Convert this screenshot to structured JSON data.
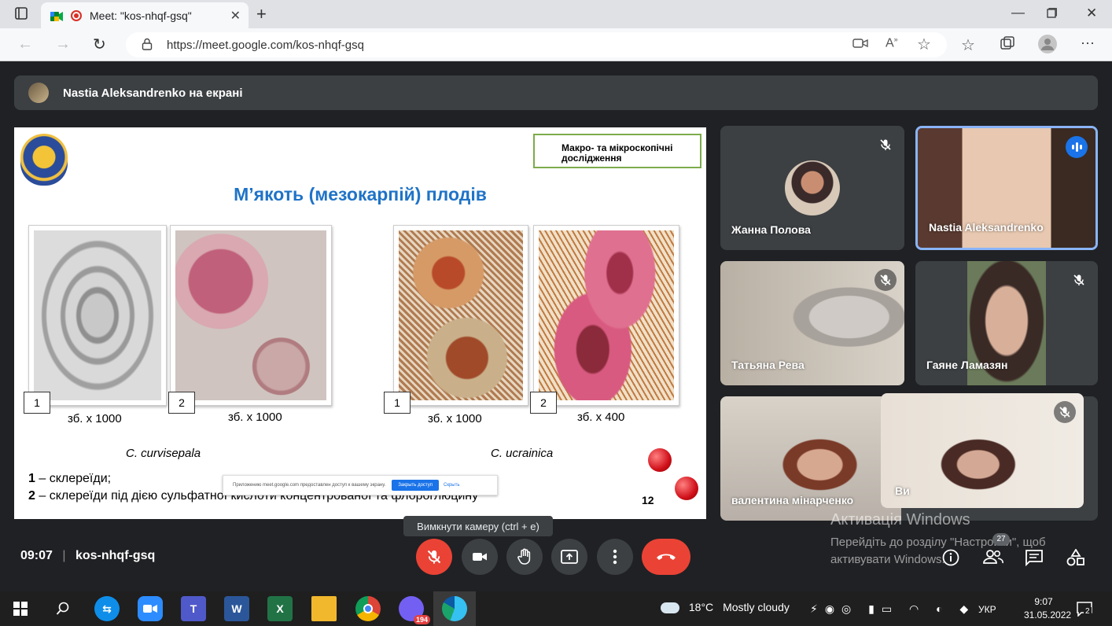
{
  "browser": {
    "tab_title": "Meet: \"kos-nhqf-gsq\"",
    "url": "https://meet.google.com/kos-nhqf-gsq"
  },
  "meet": {
    "presenter_text": "Nastia Aleksandrenko на екрані",
    "slide": {
      "label": "Макро- та мікроскопічні дослідження",
      "title": "М’якоть (мезокарпій) плодів",
      "images": [
        {
          "num": "1",
          "magnification": "зб. х 1000"
        },
        {
          "num": "2",
          "magnification": "зб. х 1000"
        },
        {
          "num": "1",
          "magnification": "зб. х 1000"
        },
        {
          "num": "2",
          "magnification": "зб. х 400"
        }
      ],
      "species_left": "C. curvisepala",
      "species_right": "C. ucrainica",
      "legend_1_num": "1",
      "legend_1_text": " – склереїди;",
      "legend_2_num": "2",
      "legend_2_text": " – склереїди під дією сульфатної кислоти концентрованої та флороглюцину",
      "page_number": "12",
      "share_banner_text": "Приложению meet.google.com предоставлен доступ к вашему экрану.",
      "share_banner_stop": "Закрыть доступ",
      "share_banner_hide": "Скрыть"
    },
    "tooltip": "Вимкнути камеру (ctrl + e)",
    "participants": [
      {
        "name": "Жанна Полова",
        "muted": true
      },
      {
        "name": "Nastia Aleksandrenko",
        "speaking": true
      },
      {
        "name": "Татьяна Рева",
        "muted": true
      },
      {
        "name": "Гаяне Ламазян",
        "muted": true
      },
      {
        "name": "валентина мінарченко",
        "muted": true
      },
      {
        "name": "Ви",
        "muted": true
      }
    ],
    "time": "09:07",
    "meeting_code": "kos-nhqf-gsq",
    "participant_count": "27",
    "windows_activation": {
      "title": "Активація Windows",
      "line1": "Перейдіть до розділу \"Настройки\", щоб",
      "line2": "активувати Windows."
    }
  },
  "taskbar": {
    "viber_badge": "194",
    "weather_temp": "18°C",
    "weather_text": "Mostly cloudy",
    "language": "УКР",
    "clock_time": "9:07",
    "clock_date": "31.05.2022",
    "notification_count": "2"
  },
  "colors": {
    "meet_bg": "#202124",
    "tile_bg": "#3c4043",
    "end_call_red": "#ea4335",
    "speaking_blue": "#1a73e8",
    "slide_title_blue": "#1f73c7"
  }
}
